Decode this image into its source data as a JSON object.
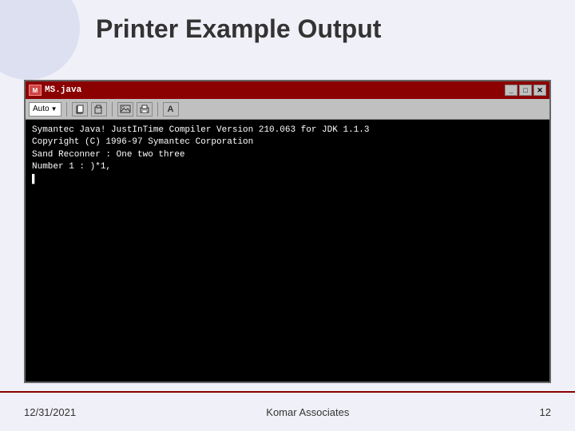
{
  "slide": {
    "title": "Printer  Example  Output",
    "deco": true
  },
  "window": {
    "title_icon": "M",
    "title_text": "MS.java",
    "controls": {
      "minimize": "_",
      "restore": "□",
      "close": "✕"
    },
    "toolbar": {
      "dropdown_value": "Auto",
      "dropdown_arrow": "▼"
    },
    "console_lines": [
      "Symantec Java! JustInTime Compiler Version 210.063 for JDK 1.1.3",
      "Copyright (C) 1996-97 Symantec Corporation",
      "",
      "Sand Reconner : One two three",
      "Number 1 : )*1,",
      "_"
    ]
  },
  "footer": {
    "date": "12/31/2021",
    "company": "Komar Associates",
    "page": "12"
  }
}
